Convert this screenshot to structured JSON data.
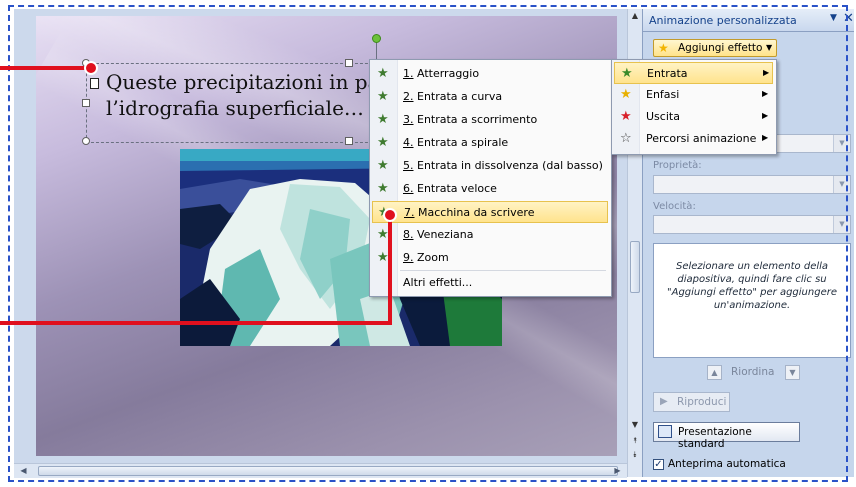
{
  "slide": {
    "text_line1": "Queste precipitazioni in pa",
    "text_line2": "l’idrografia superficiale…"
  },
  "pane": {
    "title": "Animazione personalizzata",
    "menu_glyph": "▼",
    "close_glyph": "✕",
    "add_effect": {
      "label": "Aggiungi effetto",
      "icon": "star-icon"
    },
    "fields": {
      "property_label": "Proprietà:",
      "speed_label": "Velocità:"
    },
    "info_text": "Selezionare un elemento della diapositiva, quindi fare clic su \"Aggiungi effetto\" per aggiungere un'animazione.",
    "reorder_label": "Riordina",
    "play_label": "Riproduci",
    "slideshow_label": "Presentazione standard",
    "autopreview_label": "Anteprima automatica",
    "autopreview_checked": true
  },
  "menu": {
    "items": [
      {
        "num": "1.",
        "label": "Atterraggio"
      },
      {
        "num": "2.",
        "label": "Entrata a curva"
      },
      {
        "num": "3.",
        "label": "Entrata a scorrimento"
      },
      {
        "num": "4.",
        "label": "Entrata a spirale"
      },
      {
        "num": "5.",
        "label": "Entrata in dissolvenza (dal basso)"
      },
      {
        "num": "6.",
        "label": "Entrata veloce"
      },
      {
        "num": "7.",
        "label": "Macchina da scrivere",
        "highlighted": true
      },
      {
        "num": "8.",
        "label": "Veneziana"
      },
      {
        "num": "9.",
        "label": "Zoom"
      }
    ],
    "more_label": "Altri effetti..."
  },
  "submenu": {
    "items": [
      {
        "label": "Entrata",
        "icon": "entrance-star-icon",
        "highlighted": true
      },
      {
        "label": "Enfasi",
        "icon": "emphasis-star-icon"
      },
      {
        "label": "Uscita",
        "icon": "exit-star-icon"
      },
      {
        "label": "Percorsi animazione",
        "icon": "motion-path-star-icon"
      }
    ]
  },
  "colors": {
    "callout": "#e0101e",
    "highlight": "#ffe38d",
    "frame": "#2a52c8"
  }
}
